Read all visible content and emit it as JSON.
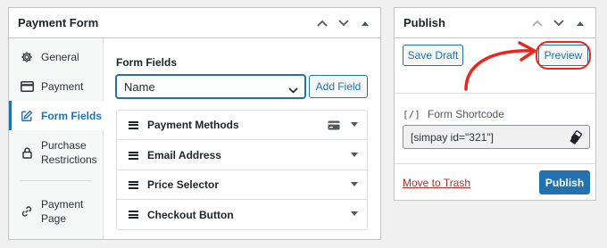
{
  "payment_form": {
    "title": "Payment Form",
    "tabs": [
      {
        "label": "General",
        "icon": "gear-icon"
      },
      {
        "label": "Payment",
        "icon": "credit-card-icon"
      },
      {
        "label": "Form Fields",
        "icon": "edit-icon",
        "active": true
      },
      {
        "label": "Purchase Restrictions",
        "line1": "Purchase",
        "line2": "Restrictions",
        "icon": "lock-icon"
      },
      {
        "label": "Payment Page",
        "line1": "Payment",
        "line2": "Page",
        "icon": "link-icon"
      }
    ],
    "form_fields_label": "Form Fields",
    "field_select_value": "Name",
    "add_field_label": "Add Field",
    "fields": [
      {
        "name": "Payment Methods",
        "has_card_icon": true
      },
      {
        "name": "Email Address"
      },
      {
        "name": "Price Selector"
      },
      {
        "name": "Checkout Button"
      }
    ]
  },
  "publish": {
    "title": "Publish",
    "save_draft_label": "Save Draft",
    "preview_label": "Preview",
    "shortcode_bracket": "[/]",
    "shortcode_label": "Form Shortcode",
    "shortcode_value": "[simpay id=\"321\"]",
    "trash_label": "Move to Trash",
    "publish_label": "Publish"
  },
  "colors": {
    "accent": "#2271b1",
    "annotation": "#e8271e",
    "danger": "#b32d2e"
  }
}
